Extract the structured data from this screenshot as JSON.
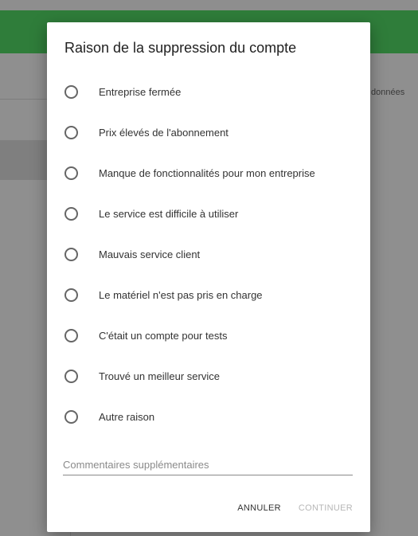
{
  "background": {
    "appbar_color": "#2f7d3a",
    "partial_text": "données"
  },
  "dialog": {
    "title": "Raison de la suppression du compte",
    "options": [
      {
        "label": "Entreprise fermée"
      },
      {
        "label": "Prix élevés de l'abonnement"
      },
      {
        "label": "Manque de fonctionnalités pour mon entreprise"
      },
      {
        "label": "Le service est difficile à utiliser"
      },
      {
        "label": "Mauvais service client"
      },
      {
        "label": "Le matériel n'est pas pris en charge"
      },
      {
        "label": "C'était un compte pour tests"
      },
      {
        "label": "Trouvé un meilleur service"
      },
      {
        "label": "Autre raison"
      }
    ],
    "comment_placeholder": "Commentaires supplémentaires",
    "comment_value": "",
    "cancel_label": "ANNULER",
    "continue_label": "CONTINUER",
    "continue_disabled": true
  }
}
